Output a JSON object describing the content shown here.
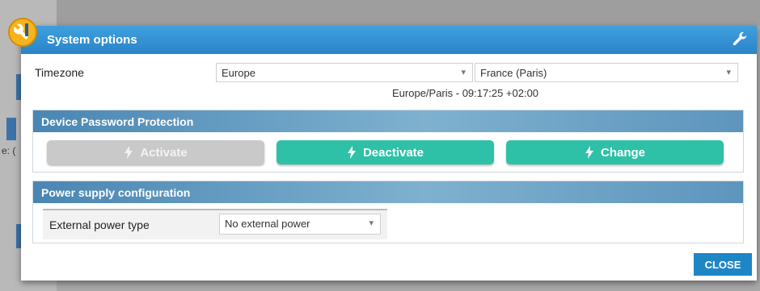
{
  "dialog": {
    "title": "System options",
    "close_label": "CLOSE"
  },
  "timezone": {
    "label": "Timezone",
    "region": "Europe",
    "city": "France (Paris)",
    "info": "Europe/Paris - 09:17:25 +02:00"
  },
  "password": {
    "title": "Device Password Protection",
    "activate_label": "Activate",
    "deactivate_label": "Deactivate",
    "change_label": "Change"
  },
  "power": {
    "title": "Power supply configuration",
    "type_label": "External power type",
    "type_value": "No external power"
  },
  "background": {
    "fragment": "e: ("
  },
  "colors": {
    "titlebar": "#2a84c8",
    "teal": "#2ec1a8",
    "disabled": "#c9c9c9",
    "close": "#1f86c6"
  },
  "icons": [
    "app-icon",
    "wrench-icon",
    "caret-down-icon",
    "bolt-icon"
  ]
}
